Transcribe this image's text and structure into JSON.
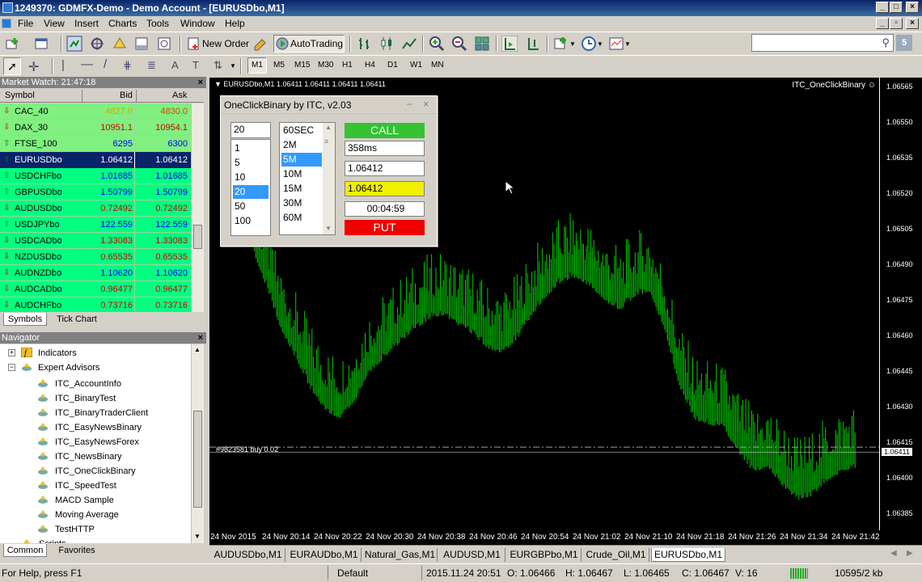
{
  "window": {
    "title": "1249370: GDMFX-Demo - Demo Account - [EURUSDbo,M1]"
  },
  "menu": [
    "File",
    "View",
    "Insert",
    "Charts",
    "Tools",
    "Window",
    "Help"
  ],
  "toolbar": {
    "new_order": "New Order",
    "auto_trading": "AutoTrading",
    "timeframes": [
      "M1",
      "M5",
      "M15",
      "M30",
      "H1",
      "H4",
      "D1",
      "W1",
      "MN"
    ],
    "search_badge": "5"
  },
  "market_watch": {
    "title": "Market Watch: 21:47:18",
    "headers": [
      "Symbol",
      "Bid",
      "Ask"
    ],
    "rows": [
      {
        "symbol": "CAC_40",
        "bid": "4827.0",
        "ask": "4830.0",
        "bid_color": "#e0a000",
        "ask_color": "#e04000",
        "dir": "down"
      },
      {
        "symbol": "DAX_30",
        "bid": "10951.1",
        "ask": "10954.1",
        "bid_color": "#d00000",
        "ask_color": "#d00000",
        "dir": "down"
      },
      {
        "symbol": "FTSE_100",
        "bid": "6295",
        "ask": "6300",
        "bid_color": "#0000ff",
        "ask_color": "#0000ff",
        "dir": "up"
      },
      {
        "symbol": "EURUSDbo",
        "bid": "1.06412",
        "ask": "1.06412",
        "bid_color": "#ffffff",
        "ask_color": "#ffffff",
        "dir": "up"
      },
      {
        "symbol": "USDCHFbo",
        "bid": "1.01685",
        "ask": "1.01685",
        "bid_color": "#0000ff",
        "ask_color": "#0000ff",
        "dir": "up"
      },
      {
        "symbol": "GBPUSDbo",
        "bid": "1.50799",
        "ask": "1.50799",
        "bid_color": "#0000ff",
        "ask_color": "#0000ff",
        "dir": "up"
      },
      {
        "symbol": "AUDUSDbo",
        "bid": "0.72492",
        "ask": "0.72492",
        "bid_color": "#d00000",
        "ask_color": "#d00000",
        "dir": "down"
      },
      {
        "symbol": "USDJPYbo",
        "bid": "122.559",
        "ask": "122.559",
        "bid_color": "#0000ff",
        "ask_color": "#0000ff",
        "dir": "up"
      },
      {
        "symbol": "USDCADbo",
        "bid": "1.33083",
        "ask": "1.33083",
        "bid_color": "#d00000",
        "ask_color": "#d00000",
        "dir": "down"
      },
      {
        "symbol": "NZDUSDbo",
        "bid": "0.65535",
        "ask": "0.65535",
        "bid_color": "#d00000",
        "ask_color": "#d00000",
        "dir": "down"
      },
      {
        "symbol": "AUDNZDbo",
        "bid": "1.10620",
        "ask": "1.10620",
        "bid_color": "#0000ff",
        "ask_color": "#0000ff",
        "dir": "down"
      },
      {
        "symbol": "AUDCADbo",
        "bid": "0.96477",
        "ask": "0.96477",
        "bid_color": "#d00000",
        "ask_color": "#d00000",
        "dir": "down"
      },
      {
        "symbol": "AUDCHFbo",
        "bid": "0.73716",
        "ask": "0.73716",
        "bid_color": "#d00000",
        "ask_color": "#d00000",
        "dir": "down"
      }
    ],
    "tabs": [
      "Symbols",
      "Tick Chart"
    ]
  },
  "navigator": {
    "title": "Navigator",
    "items": [
      "Indicators",
      "Expert Advisors",
      "ITC_AccountInfo",
      "ITC_BinaryTest",
      "ITC_BinaryTraderClient",
      "ITC_EasyNewsBinary",
      "ITC_EasyNewsForex",
      "ITC_NewsBinary",
      "ITC_OneClickBinary",
      "ITC_SpeedTest",
      "MACD Sample",
      "Moving Average",
      "TestHTTP",
      "Scripts"
    ],
    "tabs": [
      "Common",
      "Favorites"
    ]
  },
  "chart": {
    "header": "EURUSDbo,M1  1.06411 1.06411 1.06411 1.06411",
    "ea_label": "ITC_OneClickBinary ☺",
    "order_label": "#9823581 buy 0.02",
    "current_price": "1.06411",
    "price_labels": [
      "1.06565",
      "1.06550",
      "1.06535",
      "1.06520",
      "1.06505",
      "1.06490",
      "1.06475",
      "1.06460",
      "1.06445",
      "1.06430",
      "1.06415",
      "1.06400",
      "1.06385"
    ],
    "time_labels": [
      "24 Nov 2015",
      "24 Nov 20:14",
      "24 Nov 20:22",
      "24 Nov 20:30",
      "24 Nov 20:38",
      "24 Nov 20:46",
      "24 Nov 20:54",
      "24 Nov 21:02",
      "24 Nov 21:10",
      "24 Nov 21:18",
      "24 Nov 21:26",
      "24 Nov 21:34",
      "24 Nov 21:42"
    ],
    "candle_color": "#00d000"
  },
  "widget": {
    "title": "OneClickBinary by ITC, v2.03",
    "amount_value": "20",
    "amounts": [
      "1",
      "5",
      "10",
      "20",
      "50",
      "100"
    ],
    "selected_amount": "20",
    "expiries": [
      "60SEC",
      "2M",
      "5M",
      "10M",
      "15M",
      "30M",
      "60M"
    ],
    "selected_expiry": "5M",
    "call_label": "CALL",
    "put_label": "PUT",
    "latency": "358ms",
    "price1": "1.06412",
    "price2": "1.06412",
    "timer": "00:04:59"
  },
  "chart_tabs": [
    "AUDUSDbo,M1",
    "EURAUDbo,M1",
    "Natural_Gas,M1",
    "AUDUSD,M1",
    "EURGBPbo,M1",
    "Crude_Oil,M1",
    "EURUSDbo,M1"
  ],
  "status": {
    "help": "For Help, press F1",
    "profile": "Default",
    "datetime": "2015.11.24 20:51",
    "open": "O: 1.06466",
    "high": "H: 1.06467",
    "low": "L: 1.06465",
    "close": "C: 1.06467",
    "volume": "V: 16",
    "traffic": "10595/2 kb"
  }
}
